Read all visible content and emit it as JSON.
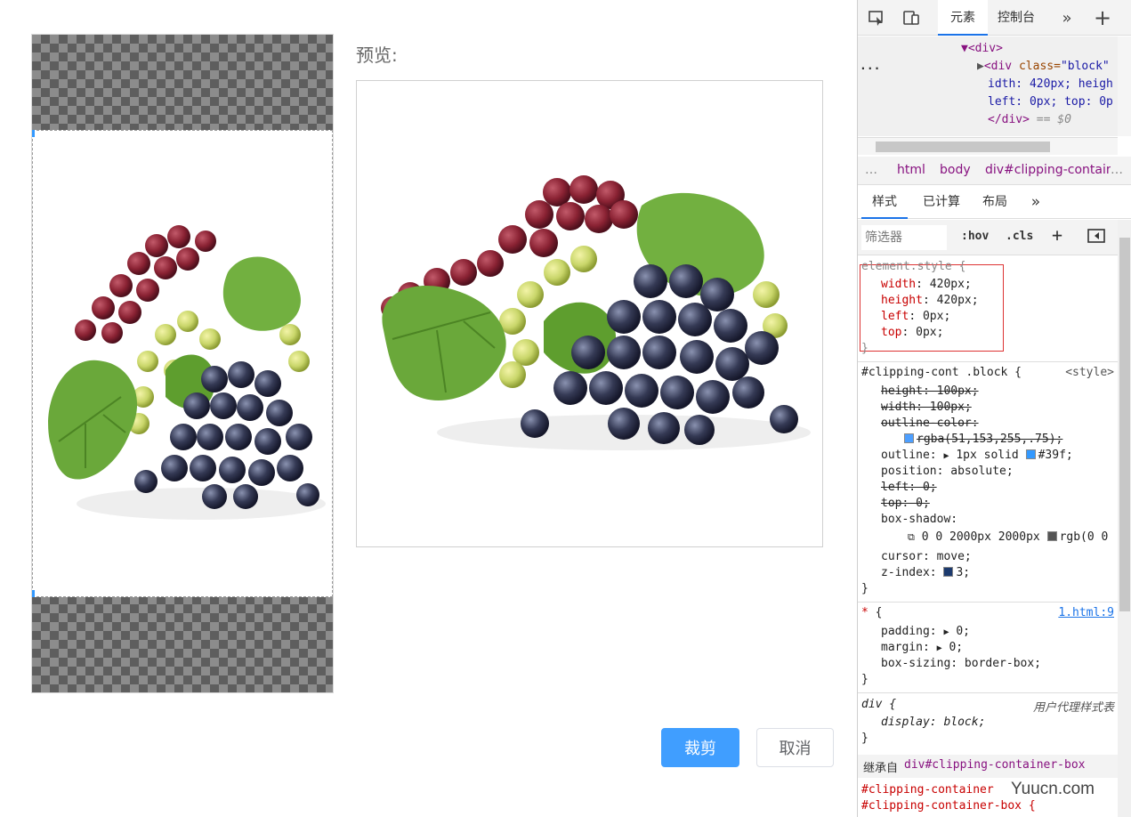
{
  "preview": {
    "label": "预览:"
  },
  "buttons": {
    "crop": "裁剪",
    "cancel": "取消"
  },
  "devtools": {
    "tabs": [
      "元素",
      "控制台"
    ],
    "dom": {
      "line1_tag": "▼<div>",
      "line2_tag": "<div ",
      "line2_attr": "class=",
      "line2_val": "\"block\"",
      "line3": "idth: 420px; heigh",
      "line4": "left: 0px; top: 0p",
      "line5_tag": "</div>",
      "line5_eq": " == $0",
      "dots": "..."
    },
    "breadcrumb": [
      "html",
      "body",
      "div#clipping-contain"
    ],
    "styles_tabs": [
      "样式",
      "已计算",
      "布局"
    ],
    "filter_placeholder": "筛选器",
    "filter_items": {
      "hov": ":hov",
      "cls": ".cls"
    },
    "element_style": {
      "selector": "element.style {",
      "props": [
        {
          "n": "width",
          "v": "420px;"
        },
        {
          "n": "height",
          "v": "420px;"
        },
        {
          "n": "left",
          "v": "0px;"
        },
        {
          "n": "top",
          "v": "0px;"
        }
      ]
    },
    "block_rule": {
      "selector": "#clipping-cont .block {",
      "source": "<style>",
      "l1": "height: 100px;",
      "l2": "width: 100px;",
      "l3": "outline-color:",
      "l4": "rgba(51,153,255,.75);",
      "l5n": "outline:",
      "l5v": "1px solid",
      "l5c": "#39f;",
      "l6": "position: absolute;",
      "l7": "left: 0;",
      "l8": "top: 0;",
      "l9": "box-shadow:",
      "l10": "0 0 2000px 2000px",
      "l10b": "rgb(0 0",
      "l11": "cursor: move;",
      "l12n": "z-index:",
      "l12v": "3;"
    },
    "star_rule": {
      "selector": "* {",
      "source": "1.html:9",
      "l1n": "padding:",
      "l1v": "0;",
      "l2n": "margin:",
      "l2v": "0;",
      "l3": "box-sizing: border-box;"
    },
    "div_rule": {
      "selector": "div {",
      "source": "用户代理样式表",
      "l1": "display: block;"
    },
    "inherited": {
      "label": "继承自",
      "from": "div#clipping-container-box"
    },
    "tail": [
      "#clipping-container",
      "#clipping-container-box {"
    ],
    "colors": {
      "accent": "#1a73e8",
      "outline": "#39f",
      "swatch_rgba": "#4d9fff"
    }
  },
  "watermark": "Yuucn.com"
}
